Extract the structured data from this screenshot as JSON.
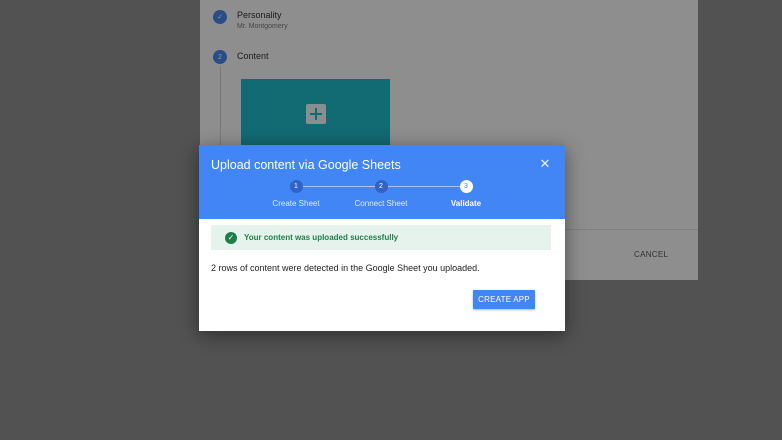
{
  "background": {
    "steps": [
      {
        "number": "✓",
        "title": "Personality",
        "subtitle": "Mr. Montgomery"
      },
      {
        "number": "2",
        "title": "Content",
        "subtitle": ""
      }
    ],
    "cancel_label": "CANCEL"
  },
  "dialog": {
    "title": "Upload content via Google Sheets",
    "close_icon": "close-icon",
    "steps": [
      {
        "number": "1",
        "label": "Create Sheet"
      },
      {
        "number": "2",
        "label": "Connect Sheet"
      },
      {
        "number": "3",
        "label": "Validate"
      }
    ],
    "success_message": "Your content was uploaded successfully",
    "detected_text": "2 rows of content were detected in the Google Sheet you uploaded.",
    "create_button": "CREATE APP"
  },
  "colors": {
    "primary": "#4285f4",
    "success_text": "#1e7e4a",
    "success_bg": "#e6f3ec",
    "tile": "#1fb7c6"
  }
}
